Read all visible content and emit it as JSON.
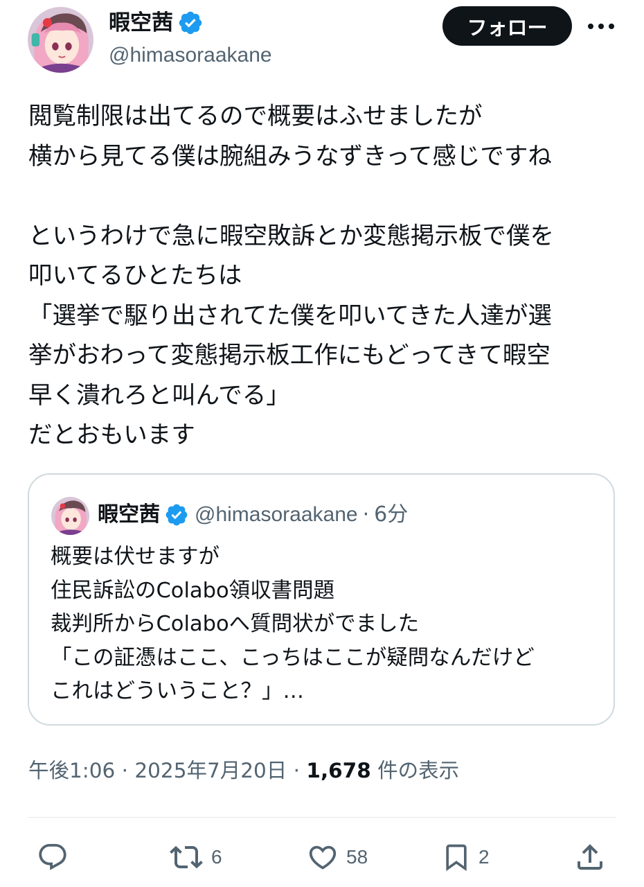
{
  "author": {
    "display_name": "暇空茜",
    "handle": "@himasoraakane",
    "avatar_icon": "avatar-image",
    "verified_icon": "verified-badge-icon"
  },
  "header": {
    "follow_label": "フォロー",
    "more_icon": "more-options-icon"
  },
  "tweet": {
    "text": "閲覧制限は出てるので概要はふせましたが\n横から見てる僕は腕組みうなずきって感じですね\n\nというわけで急に暇空敗訴とか変態掲示板で僕を\n叩いてるひとたちは\n「選挙で駆り出されてた僕を叩いてきた人達が選\n挙がおわって変態掲示板工作にもどってきて暇空\n早く潰れろと叫んでる」\nだとおもいます"
  },
  "quote": {
    "display_name": "暇空茜",
    "handle": "@himasoraakane",
    "separator": "·",
    "time": "6分",
    "text": "概要は伏せますが\n住民訴訟のColabo領収書問題\n裁判所からColaboへ質問状がでました\n「この証憑はここ、こっちはここが疑問なんだけど\nこれはどういうこと？」…"
  },
  "meta": {
    "time": "午後1:06",
    "sep1": " · ",
    "date": "2025年7月20日",
    "sep2": " · ",
    "views": "1,678",
    "views_label": " 件の表示"
  },
  "actions": {
    "reply": {
      "icon": "reply-icon",
      "count": ""
    },
    "retweet": {
      "icon": "retweet-icon",
      "count": "6"
    },
    "like": {
      "icon": "heart-icon",
      "count": "58"
    },
    "bookmark": {
      "icon": "bookmark-icon",
      "count": "2"
    },
    "share": {
      "icon": "share-icon",
      "count": ""
    }
  },
  "colors": {
    "text": "#0f1419",
    "secondary": "#536471",
    "verified": "#1d9bf0",
    "border": "#cfd9de",
    "follow_bg": "#0f1419"
  }
}
